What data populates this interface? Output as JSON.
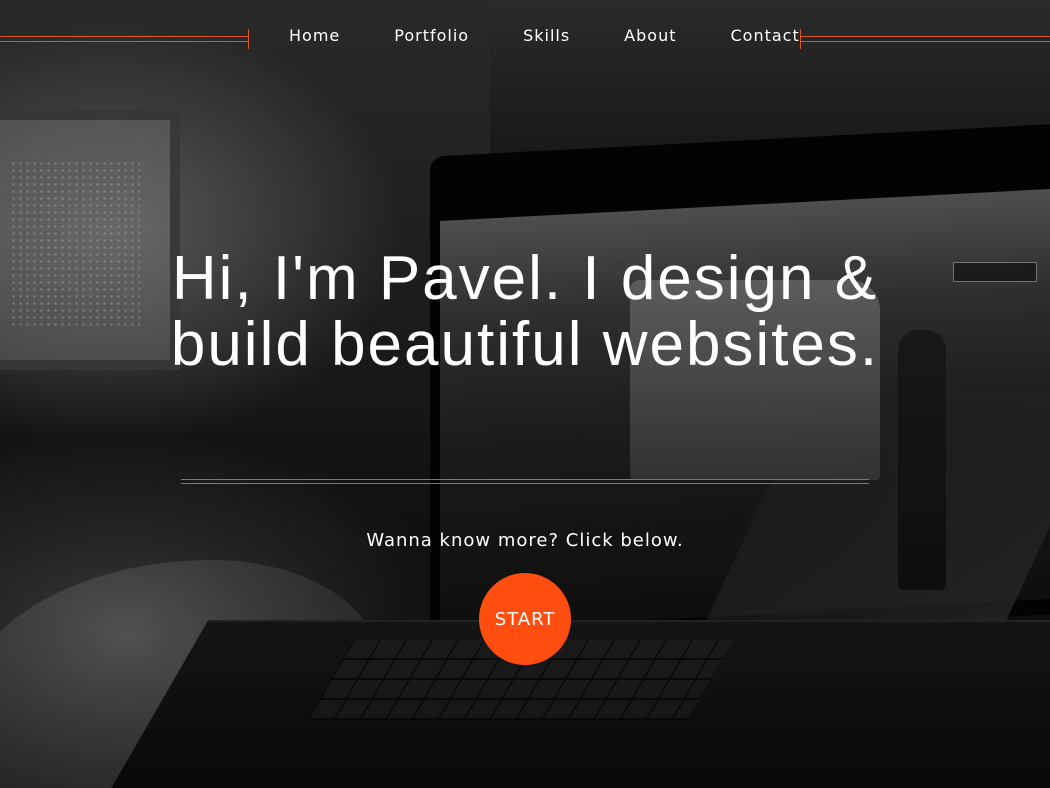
{
  "nav": {
    "items": [
      {
        "label": "Home"
      },
      {
        "label": "Portfolio"
      },
      {
        "label": "Skills"
      },
      {
        "label": "About"
      },
      {
        "label": "Contact"
      }
    ]
  },
  "hero": {
    "headline": "Hi, I'm Pavel. I design & build beautiful websites.",
    "subtext": "Wanna know more? Click below.",
    "cta_label": "START",
    "accent_color": "#ff4e0f",
    "line_color": "#e0551f",
    "background_image": "dark photo of a laptop on a desk displaying a train station scene"
  }
}
